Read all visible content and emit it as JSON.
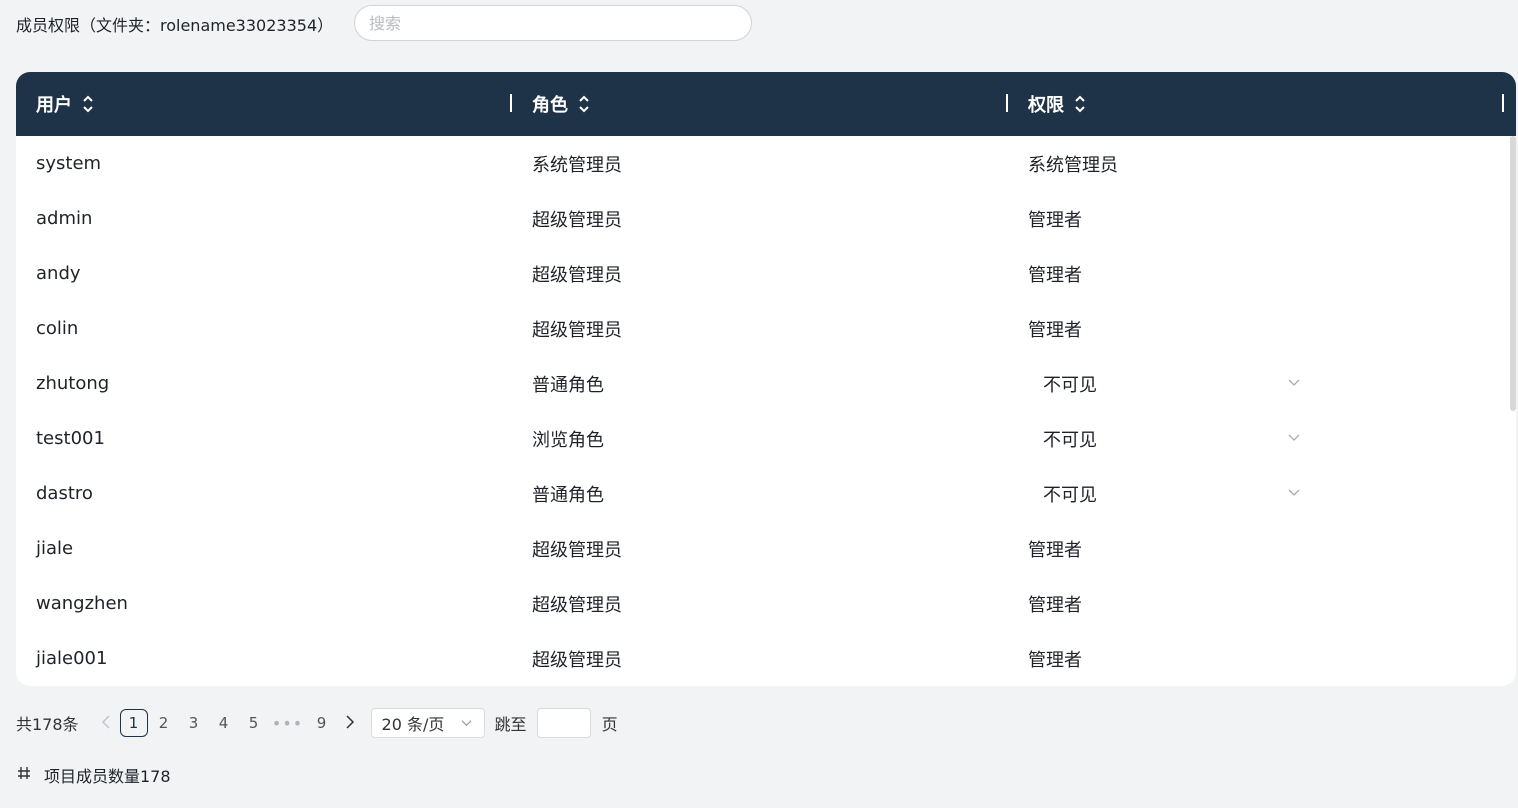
{
  "header": {
    "title": "成员权限（文件夹：rolename33023354）",
    "search_placeholder": "搜索"
  },
  "table": {
    "columns": [
      "用户",
      "角色",
      "权限"
    ],
    "rows": [
      {
        "user": "system",
        "role": "系统管理员",
        "permission": "系统管理员",
        "editable": false
      },
      {
        "user": "admin",
        "role": "超级管理员",
        "permission": "管理者",
        "editable": false
      },
      {
        "user": "andy",
        "role": "超级管理员",
        "permission": "管理者",
        "editable": false
      },
      {
        "user": "colin",
        "role": "超级管理员",
        "permission": "管理者",
        "editable": false
      },
      {
        "user": "zhutong",
        "role": "普通角色",
        "permission": "不可见",
        "editable": true
      },
      {
        "user": "test001",
        "role": "浏览角色",
        "permission": "不可见",
        "editable": true
      },
      {
        "user": "dastro",
        "role": "普通角色",
        "permission": "不可见",
        "editable": true
      },
      {
        "user": "jiale",
        "role": "超级管理员",
        "permission": "管理者",
        "editable": false
      },
      {
        "user": "wangzhen",
        "role": "超级管理员",
        "permission": "管理者",
        "editable": false
      },
      {
        "user": "jiale001",
        "role": "超级管理员",
        "permission": "管理者",
        "editable": false
      }
    ]
  },
  "pagination": {
    "total_label": "共178条",
    "pages": [
      "1",
      "2",
      "3",
      "4",
      "5"
    ],
    "current": "1",
    "ellipsis": "•••",
    "last_page": "9",
    "page_size_label": "20 条/页",
    "jump_label": "跳至",
    "page_unit": "页"
  },
  "footer": {
    "count_label": "项目成员数量178"
  },
  "colors": {
    "header_bg": "#1e3347",
    "page_bg": "#f2f3f5"
  }
}
